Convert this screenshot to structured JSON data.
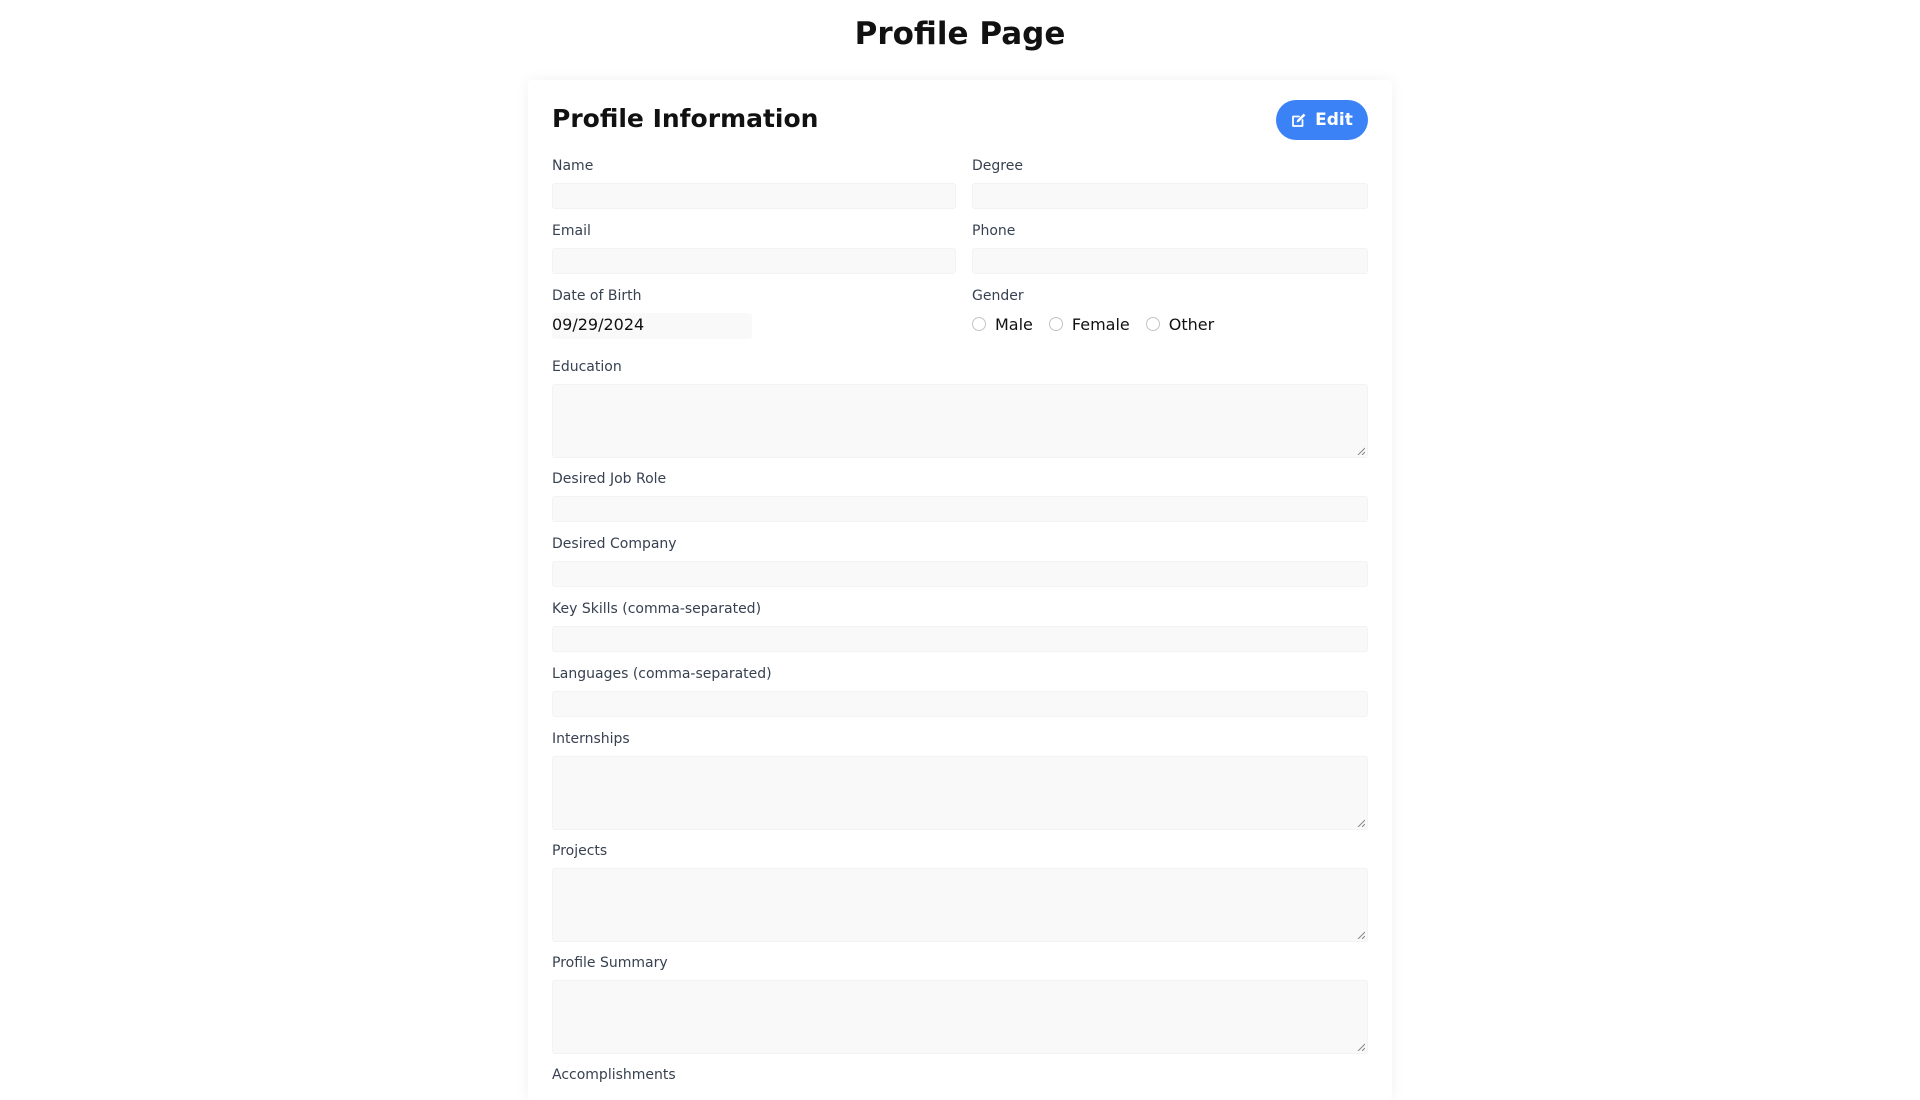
{
  "page": {
    "title": "Profile Page"
  },
  "profile_card": {
    "title": "Profile Information",
    "edit_label": "Edit",
    "accent_color": "#3b82f6"
  },
  "fields": {
    "name": {
      "label": "Name",
      "value": ""
    },
    "degree": {
      "label": "Degree",
      "value": ""
    },
    "email": {
      "label": "Email",
      "value": ""
    },
    "phone": {
      "label": "Phone",
      "value": ""
    },
    "date_of_birth": {
      "label": "Date of Birth",
      "value": "09/29/2024"
    },
    "gender": {
      "label": "Gender",
      "options": [
        "Male",
        "Female",
        "Other"
      ],
      "selected": null
    },
    "education": {
      "label": "Education",
      "value": ""
    },
    "desired_job_role": {
      "label": "Desired Job Role",
      "value": ""
    },
    "desired_company": {
      "label": "Desired Company",
      "value": ""
    },
    "key_skills": {
      "label": "Key Skills (comma-separated)",
      "value": ""
    },
    "languages": {
      "label": "Languages (comma-separated)",
      "value": ""
    },
    "internships": {
      "label": "Internships",
      "value": ""
    },
    "projects": {
      "label": "Projects",
      "value": ""
    },
    "profile_summary": {
      "label": "Profile Summary",
      "value": ""
    },
    "accomplishments": {
      "label": "Accomplishments",
      "value": ""
    }
  },
  "icons": {
    "edit": "edit-icon",
    "resize": "resize-grip-icon",
    "radio": "radio-button"
  }
}
